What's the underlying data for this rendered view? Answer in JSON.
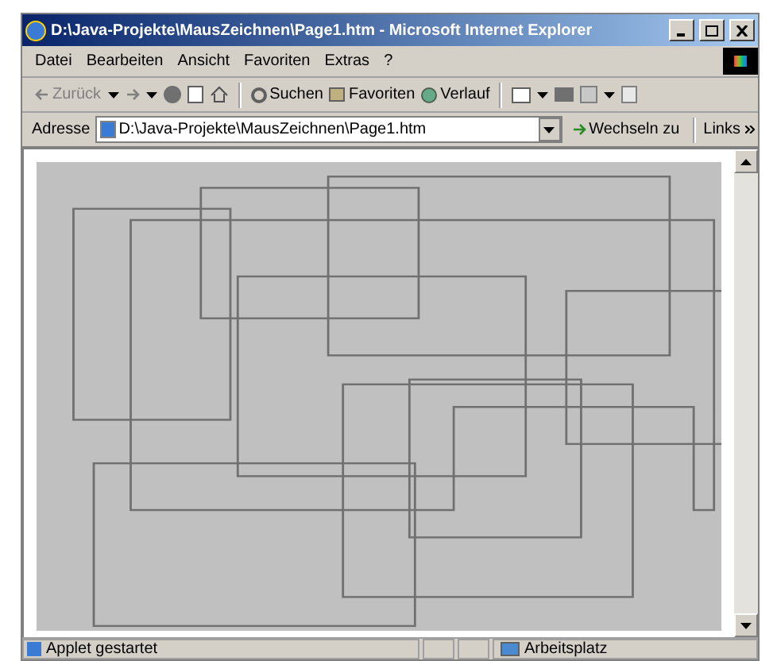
{
  "window": {
    "title": "D:\\Java-Projekte\\MausZeichnen\\Page1.htm - Microsoft Internet Explorer"
  },
  "menu": [
    "Datei",
    "Bearbeiten",
    "Ansicht",
    "Favoriten",
    "Extras",
    "?"
  ],
  "toolbar": {
    "back": "Zurück",
    "search": "Suchen",
    "favorites": "Favoriten",
    "history": "Verlauf"
  },
  "address_bar": {
    "label": "Adresse",
    "value": "D:\\Java-Projekte\\MausZeichnen\\Page1.htm",
    "go": "Wechseln zu",
    "links": "Links"
  },
  "status_bar": {
    "message": "Applet gestartet",
    "zone": "Arbeitsplatz"
  }
}
